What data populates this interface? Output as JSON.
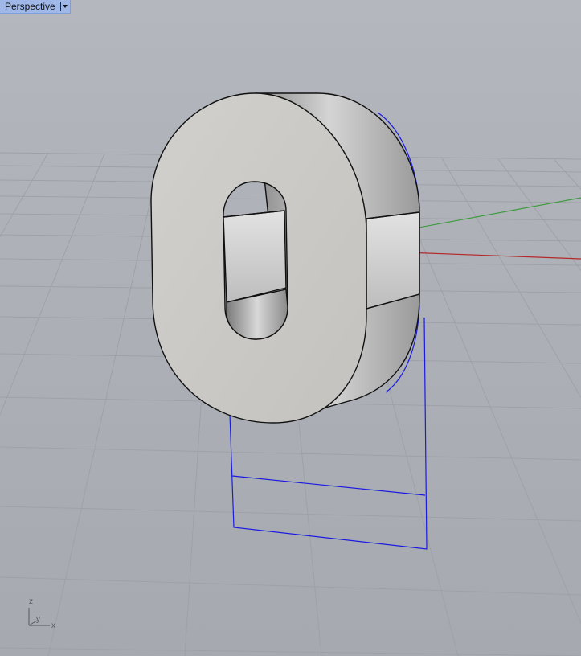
{
  "viewport": {
    "name": "Perspective",
    "dropdown_icon": "chevron-down-icon",
    "background_color": "#b0b4ba",
    "grid_color": "#9ea2a8",
    "x_axis_color": "#b22a2a",
    "y_axis_color": "#3f9a3f",
    "selection_color": "#1a1ae0",
    "object_face_color": "#c9c7c3",
    "object_edge_color": "#111111"
  },
  "axis_widget": {
    "z_label": "z",
    "y_label": "y",
    "x_label": "x"
  }
}
